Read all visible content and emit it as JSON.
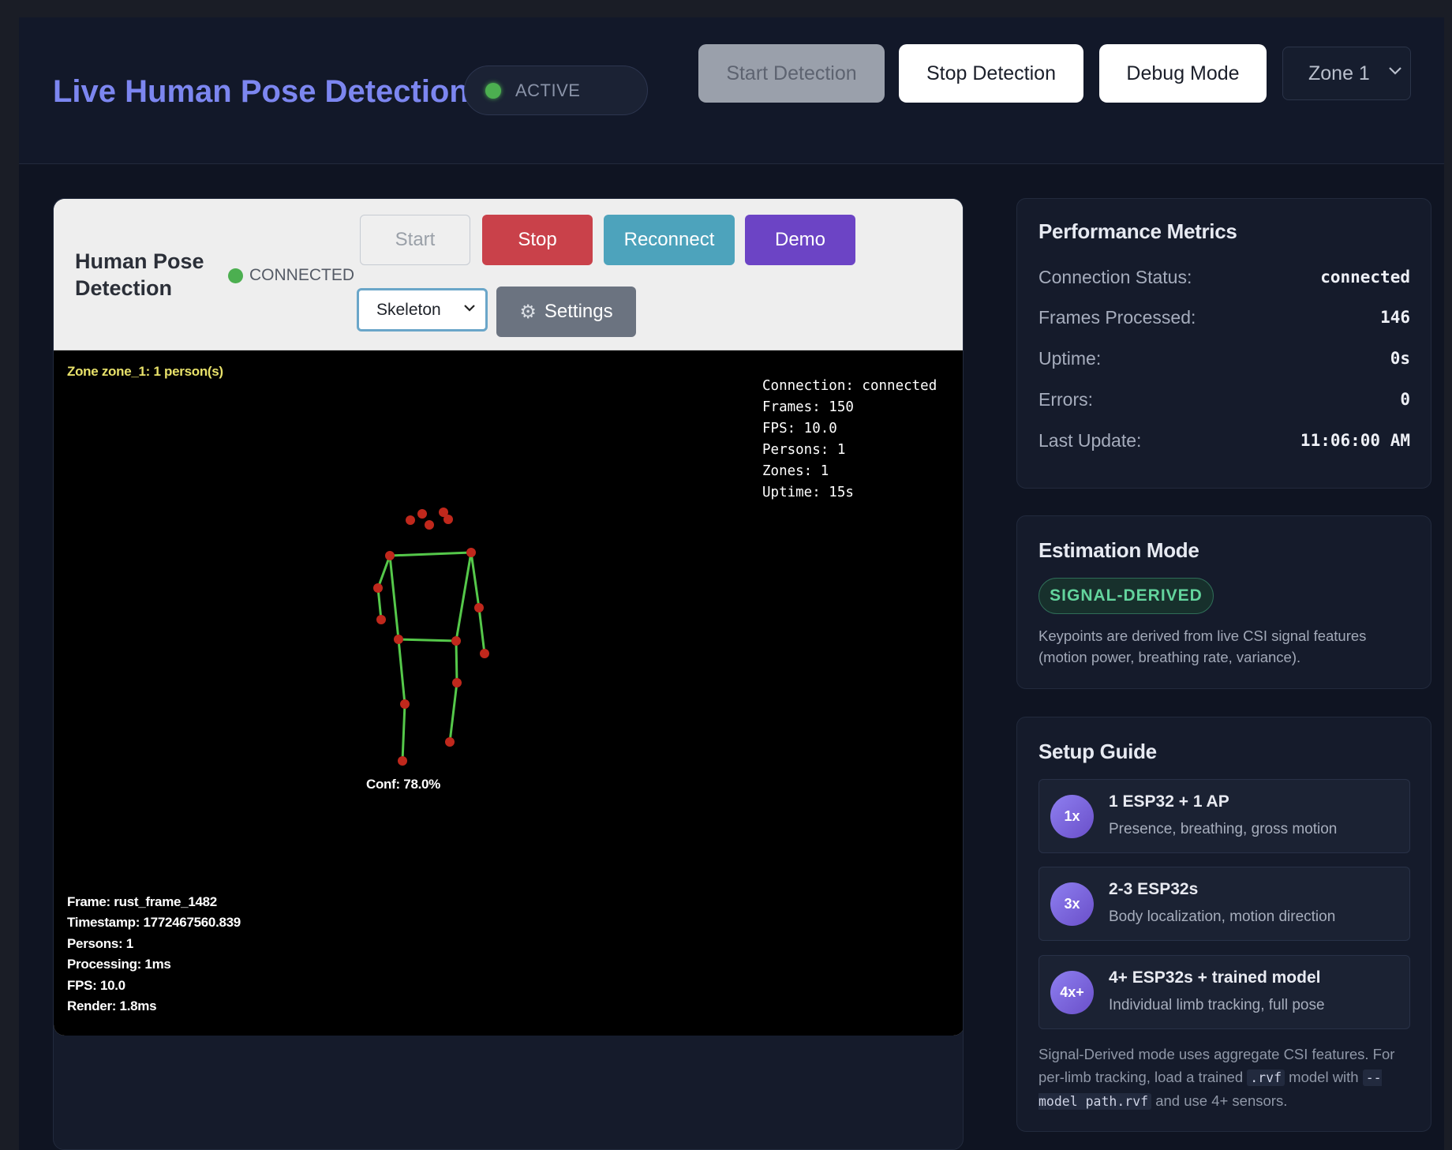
{
  "header": {
    "title": "Live Human Pose Detection",
    "status": "ACTIVE",
    "buttons": {
      "start": "Start Detection",
      "stop": "Stop Detection",
      "debug": "Debug Mode"
    },
    "zone_select": "Zone 1"
  },
  "detector": {
    "title": "Human Pose Detection",
    "connection": "CONNECTED",
    "buttons": {
      "start": "Start",
      "stop": "Stop",
      "reconnect": "Reconnect",
      "demo": "Demo",
      "settings": "Settings"
    },
    "mode_select": "Skeleton",
    "canvas": {
      "zone_label": "Zone zone_1: 1 person(s)",
      "stats_top": "Connection: connected\nFrames: 150\nFPS: 10.0\nPersons: 1\nZones: 1\nUptime: 15s",
      "stats_bottom": "Frame: rust_frame_1482\nTimestamp: 1772467560.839\nPersons: 1\nProcessing: 1ms\nFPS: 10.0\nRender: 1.8ms",
      "confidence": "Conf: 78.0%"
    }
  },
  "metrics": {
    "title": "Performance Metrics",
    "rows": [
      {
        "label": "Connection Status:",
        "value": "connected"
      },
      {
        "label": "Frames Processed:",
        "value": "146"
      },
      {
        "label": "Uptime:",
        "value": "0s"
      },
      {
        "label": "Errors:",
        "value": "0"
      },
      {
        "label": "Last Update:",
        "value": "11:06:00 AM"
      }
    ]
  },
  "estimation": {
    "title": "Estimation Mode",
    "badge": "SIGNAL-DERIVED",
    "description": "Keypoints are derived from live CSI signal features (motion power, breathing rate, variance)."
  },
  "setup": {
    "title": "Setup Guide",
    "items": [
      {
        "badge": "1x",
        "title": "1 ESP32 + 1 AP",
        "subtitle": "Presence, breathing, gross motion"
      },
      {
        "badge": "3x",
        "title": "2-3 ESP32s",
        "subtitle": "Body localization, motion direction"
      },
      {
        "badge": "4x+",
        "title": "4+ ESP32s + trained model",
        "subtitle": "Individual limb tracking, full pose"
      }
    ],
    "note_a": "Signal-Derived mode uses aggregate CSI features. For per-limb tracking, load a trained ",
    "note_code1": ".rvf",
    "note_b": " model with ",
    "note_code2": "--model path.rvf",
    "note_c": " and use 4+ sensors."
  },
  "colors": {
    "accent": "#7c86f0",
    "skeleton_line": "#55c84a",
    "keypoint": "#c0281c",
    "zone_label": "#e8e16a",
    "status_green": "#4caf50"
  }
}
